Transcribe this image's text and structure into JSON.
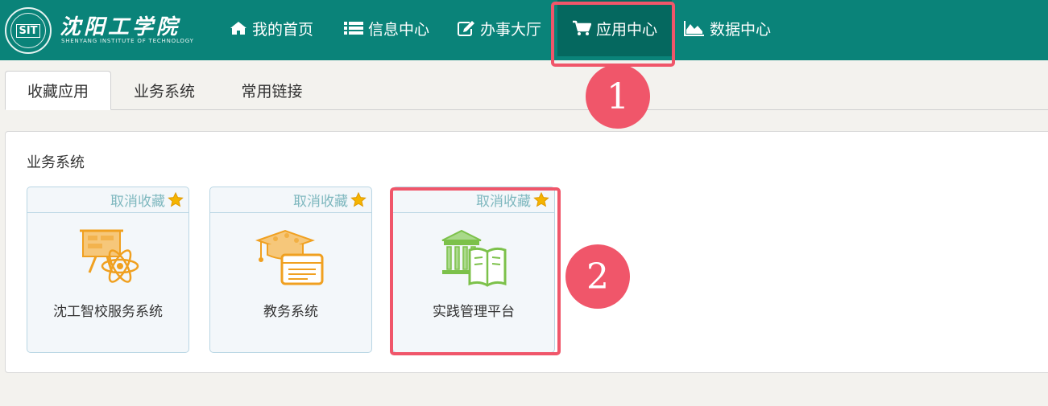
{
  "header": {
    "logo_seal": "SIT",
    "logo_cn": "沈阳工学院",
    "logo_en": "SHENYANG INSTITUTE OF TECHNOLOGY",
    "nav": [
      {
        "label": "我的首页",
        "icon": "home-icon"
      },
      {
        "label": "信息中心",
        "icon": "list-icon"
      },
      {
        "label": "办事大厅",
        "icon": "edit-icon"
      },
      {
        "label": "应用中心",
        "icon": "cart-icon",
        "active": true
      },
      {
        "label": "数据中心",
        "icon": "area-chart-icon"
      }
    ]
  },
  "tabs": [
    {
      "label": "收藏应用",
      "active": true
    },
    {
      "label": "业务系统",
      "active": false
    },
    {
      "label": "常用链接",
      "active": false
    }
  ],
  "panel": {
    "title": "业务系统",
    "unfav_label": "取消收藏",
    "cards": [
      {
        "label": "沈工智校服务系统",
        "icon": "smart-campus-icon"
      },
      {
        "label": "教务系统",
        "icon": "academic-cap-icon"
      },
      {
        "label": "实践管理平台",
        "icon": "practice-platform-icon"
      }
    ]
  },
  "annotations": {
    "badge_1": "1",
    "badge_2": "2"
  },
  "colors": {
    "header_bg": "#0a8379",
    "header_active": "#05685f",
    "annotation": "#f0566a",
    "unfav_text": "#7fb8bf",
    "star": "#f5b400",
    "icon_orange": "#f0a020",
    "icon_green": "#7cc14a"
  }
}
